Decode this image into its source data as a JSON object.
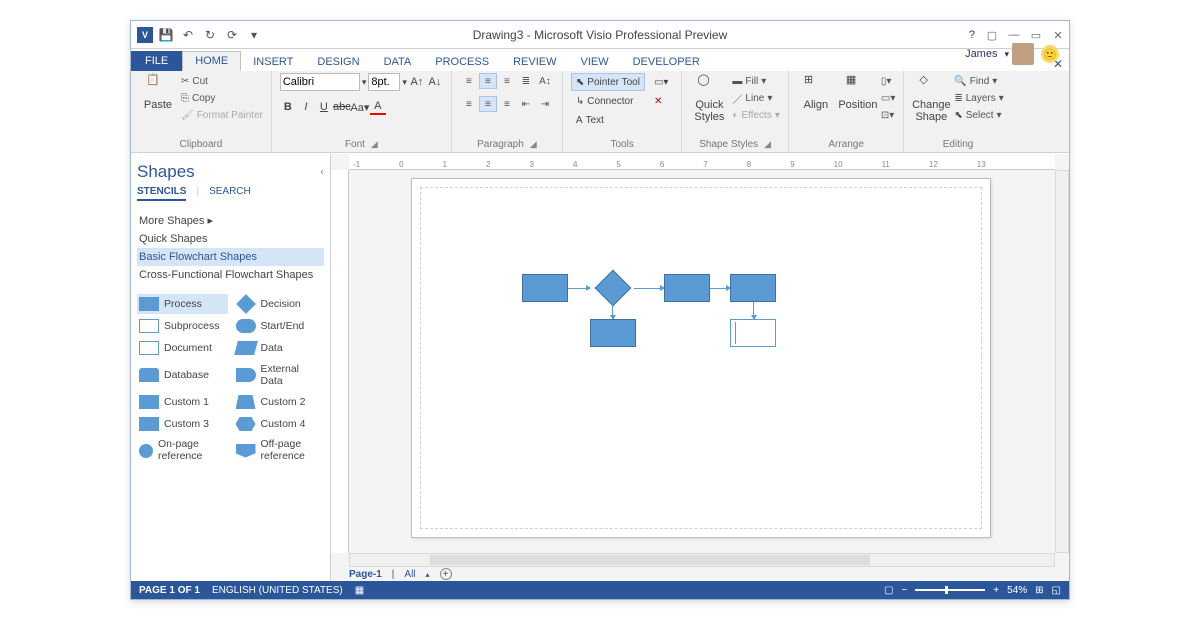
{
  "titlebar": {
    "title": "Drawing3 - Microsoft Visio Professional Preview",
    "user": "James"
  },
  "tabs": {
    "file": "FILE",
    "home": "HOME",
    "insert": "INSERT",
    "design": "DESIGN",
    "data": "DATA",
    "process": "PROCESS",
    "review": "REVIEW",
    "view": "VIEW",
    "developer": "DEVELOPER"
  },
  "ribbon": {
    "clipboard": {
      "paste": "Paste",
      "cut": "Cut",
      "copy": "Copy",
      "fmt": "Format Painter",
      "label": "Clipboard"
    },
    "font": {
      "name": "Calibri",
      "size": "8pt.",
      "label": "Font"
    },
    "para": {
      "label": "Paragraph"
    },
    "tools": {
      "pointer": "Pointer Tool",
      "connector": "Connector",
      "text": "Text",
      "label": "Tools"
    },
    "shape": {
      "quick": "Quick\nStyles",
      "fill": "Fill",
      "line": "Line",
      "effects": "Effects",
      "label": "Shape Styles"
    },
    "arrange": {
      "align": "Align",
      "position": "Position",
      "label": "Arrange"
    },
    "editing": {
      "change": "Change\nShape",
      "find": "Find",
      "layers": "Layers",
      "select": "Select",
      "label": "Editing"
    }
  },
  "shapes_panel": {
    "title": "Shapes",
    "tabs": {
      "stencils": "STENCILS",
      "search": "SEARCH"
    },
    "stencils": {
      "more": "More Shapes",
      "quick": "Quick Shapes",
      "basic": "Basic Flowchart Shapes",
      "cross": "Cross-Functional Flowchart Shapes"
    },
    "items": [
      {
        "l": "Process"
      },
      {
        "l": "Decision"
      },
      {
        "l": "Subprocess"
      },
      {
        "l": "Start/End"
      },
      {
        "l": "Document"
      },
      {
        "l": "Data"
      },
      {
        "l": "Database"
      },
      {
        "l": "External Data"
      },
      {
        "l": "Custom 1"
      },
      {
        "l": "Custom 2"
      },
      {
        "l": "Custom 3"
      },
      {
        "l": "Custom 4"
      },
      {
        "l": "On-page reference"
      },
      {
        "l": "Off-page reference"
      }
    ]
  },
  "canvas": {
    "page_tab": "Page-1",
    "all": "All"
  },
  "statusbar": {
    "page": "PAGE 1 OF 1",
    "lang": "ENGLISH (UNITED STATES)",
    "zoom": "54%"
  }
}
